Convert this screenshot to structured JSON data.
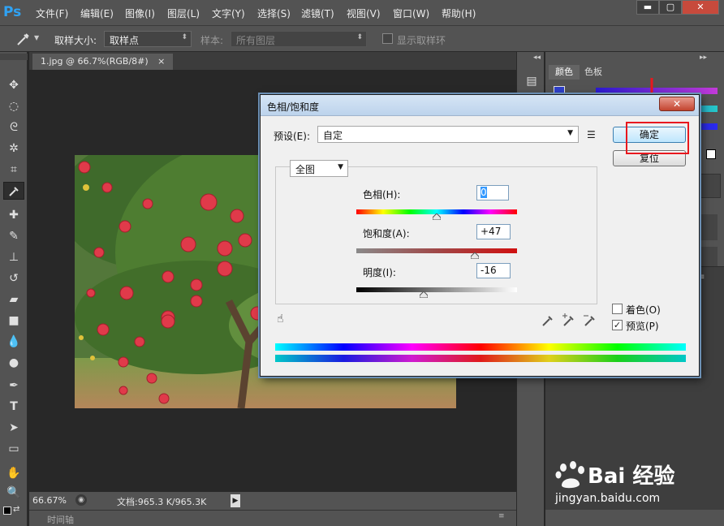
{
  "app": {
    "logo": "Ps",
    "menu": [
      "文件(F)",
      "编辑(E)",
      "图像(I)",
      "图层(L)",
      "文字(Y)",
      "选择(S)",
      "滤镜(T)",
      "视图(V)",
      "窗口(W)",
      "帮助(H)"
    ],
    "window_buttons": [
      "minimize-icon",
      "maximize-icon",
      "close-icon"
    ]
  },
  "options_bar": {
    "tool_icon": "eyedropper-icon",
    "sample_size_label": "取样大小:",
    "sample_size_value": "取样点",
    "sample_label": "样本:",
    "sample_value": "所有图层",
    "show_ring_label": "显示取样环"
  },
  "document": {
    "tab_title": "1.jpg @ 66.7%(RGB/8#)",
    "tab_close": "×",
    "zoom": "66.67%",
    "doc_info": "文档:965.3 K/965.3K",
    "timeline_label": "时间轴"
  },
  "right_panel": {
    "tabs": [
      "颜色",
      "色板"
    ]
  },
  "dialog": {
    "title": "色相/饱和度",
    "close": "✕",
    "preset_label": "预设(E):",
    "preset_value": "自定",
    "ok_label": "确定",
    "reset_label": "复位",
    "channel_value": "全图",
    "hue_label": "色相(H):",
    "hue_value": "0",
    "saturation_label": "饱和度(A):",
    "saturation_value": "+47",
    "lightness_label": "明度(I):",
    "lightness_value": "-16",
    "colorize_label": "着色(O)",
    "colorize_checked": false,
    "preview_label": "预览(P)",
    "preview_checked": true
  },
  "watermark": {
    "brand": "Bai 经验",
    "url": "jingyan.baidu.com"
  },
  "colors": {
    "highlight": "#e8181e",
    "ps_blue": "#2fa3f5"
  }
}
